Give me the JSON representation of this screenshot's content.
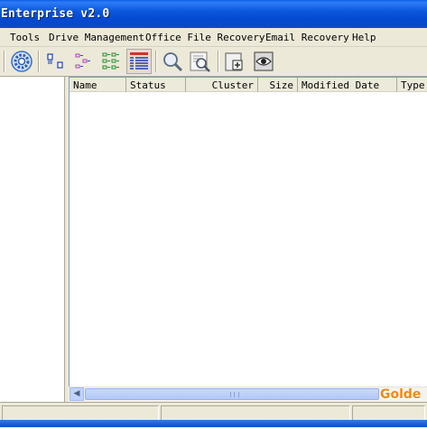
{
  "window": {
    "title": "Enterprise v2.0"
  },
  "menubar": {
    "items": [
      {
        "label": "Tools"
      },
      {
        "label": "Drive Management"
      },
      {
        "label": "Office File Recovery"
      },
      {
        "label": "Email Recovery"
      },
      {
        "label": "Help"
      }
    ]
  },
  "toolbar": {
    "buttons": [
      {
        "icon": "gear-icon"
      },
      {
        "icon": "large-icons-view-icon"
      },
      {
        "icon": "small-icons-view-icon"
      },
      {
        "icon": "list-view-icon"
      },
      {
        "icon": "details-view-icon",
        "selected": true
      },
      {
        "icon": "search-icon"
      },
      {
        "icon": "advanced-search-icon"
      },
      {
        "icon": "recover-folder-icon"
      },
      {
        "icon": "preview-icon"
      }
    ]
  },
  "file_list": {
    "columns": [
      {
        "label": "Name"
      },
      {
        "label": "Status"
      },
      {
        "label": "Cluster"
      },
      {
        "label": "Size"
      },
      {
        "label": "Modified Date"
      },
      {
        "label": "Type"
      }
    ],
    "rows": []
  },
  "watermark": {
    "text": "Golde"
  },
  "statusbar": {
    "panels": [
      "",
      "",
      ""
    ]
  }
}
